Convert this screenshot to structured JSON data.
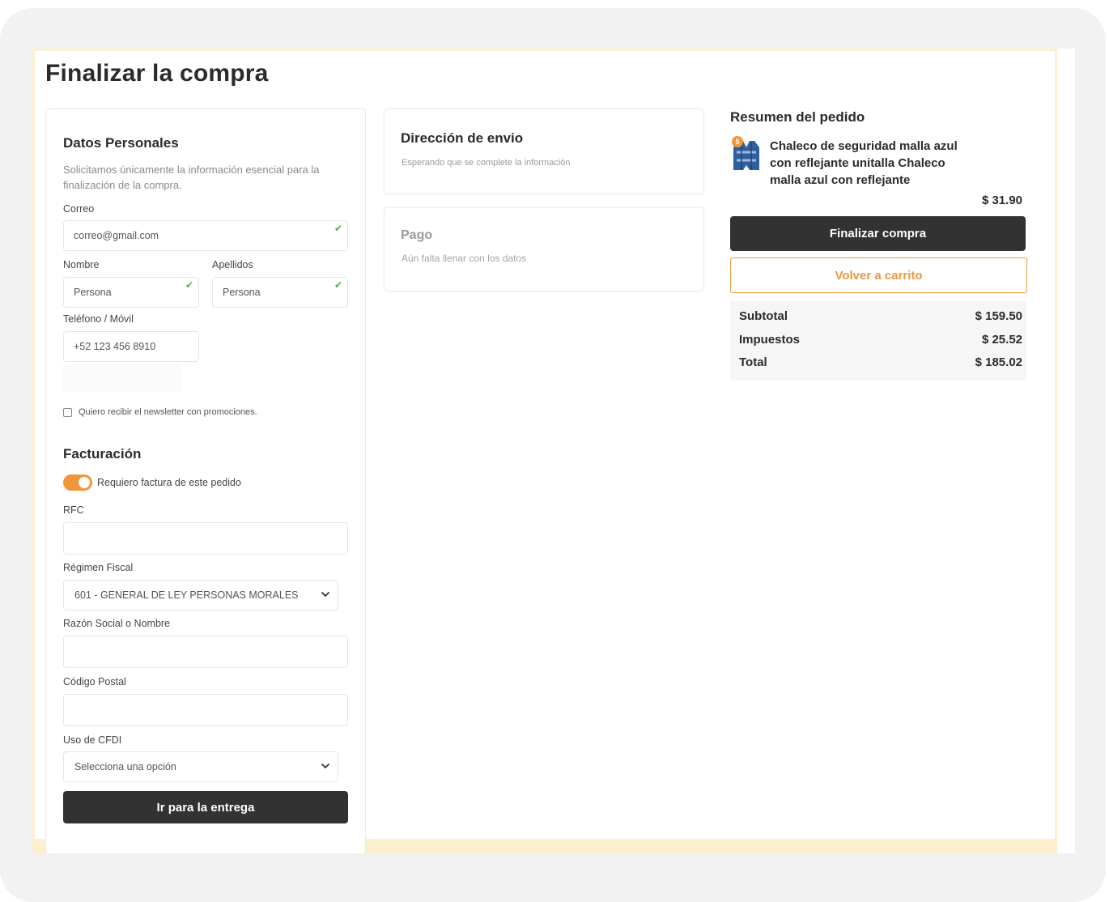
{
  "page": {
    "title": "Finalizar la compra"
  },
  "personal": {
    "heading": "Datos Personales",
    "description": "Solicitamos únicamente la información esencial para la finalización de la compra.",
    "email_label": "Correo",
    "email_value": "correo@gmail.com",
    "name_label": "Nombre",
    "name_value": "Persona",
    "lastname_label": "Apellidos",
    "lastname_value": "Persona",
    "phone_label": "Teléfono / Móvil",
    "phone_value": "+52 123 456 8910",
    "newsletter_label": "Quiero recibir el newsletter con promociones."
  },
  "billing": {
    "heading": "Facturación",
    "toggle_label": "Requiero factura de este pedido",
    "toggle_on": true,
    "rfc_label": "RFC",
    "rfc_value": "",
    "regimen_label": "Régimen Fiscal",
    "regimen_value": "601 - GENERAL DE LEY PERSONAS MORALES",
    "razon_label": "Razón Social o Nombre",
    "razon_value": "",
    "cp_label": "Código Postal",
    "cp_value": "",
    "cfdi_label": "Uso de CFDI",
    "cfdi_value": "Selecciona una opción",
    "submit_label": "Ir para la entrega"
  },
  "shipping": {
    "heading": "Dirección de envio",
    "status": "Esperando que se complete la información"
  },
  "payment": {
    "heading": "Pago",
    "status": "Aún falta llenar con los datos"
  },
  "summary": {
    "heading": "Resumen del pedido",
    "product": {
      "name": "Chaleco de seguridad malla azul con reflejante unitalla Chaleco malla azul con reflejante",
      "quantity": "5",
      "price": "$ 31.90",
      "icon": "vest-icon"
    },
    "checkout_label": "Finalizar compra",
    "back_label": "Volver a carrito",
    "subtotal_label": "Subtotal",
    "subtotal_value": "$ 159.50",
    "taxes_label": "Impuestos",
    "taxes_value": "$ 25.52",
    "total_label": "Total",
    "total_value": "$ 185.02"
  },
  "colors": {
    "accent": "#f0953a",
    "dark_button": "#323232",
    "success": "#4caf50",
    "page_border": "#fdf0d0"
  }
}
